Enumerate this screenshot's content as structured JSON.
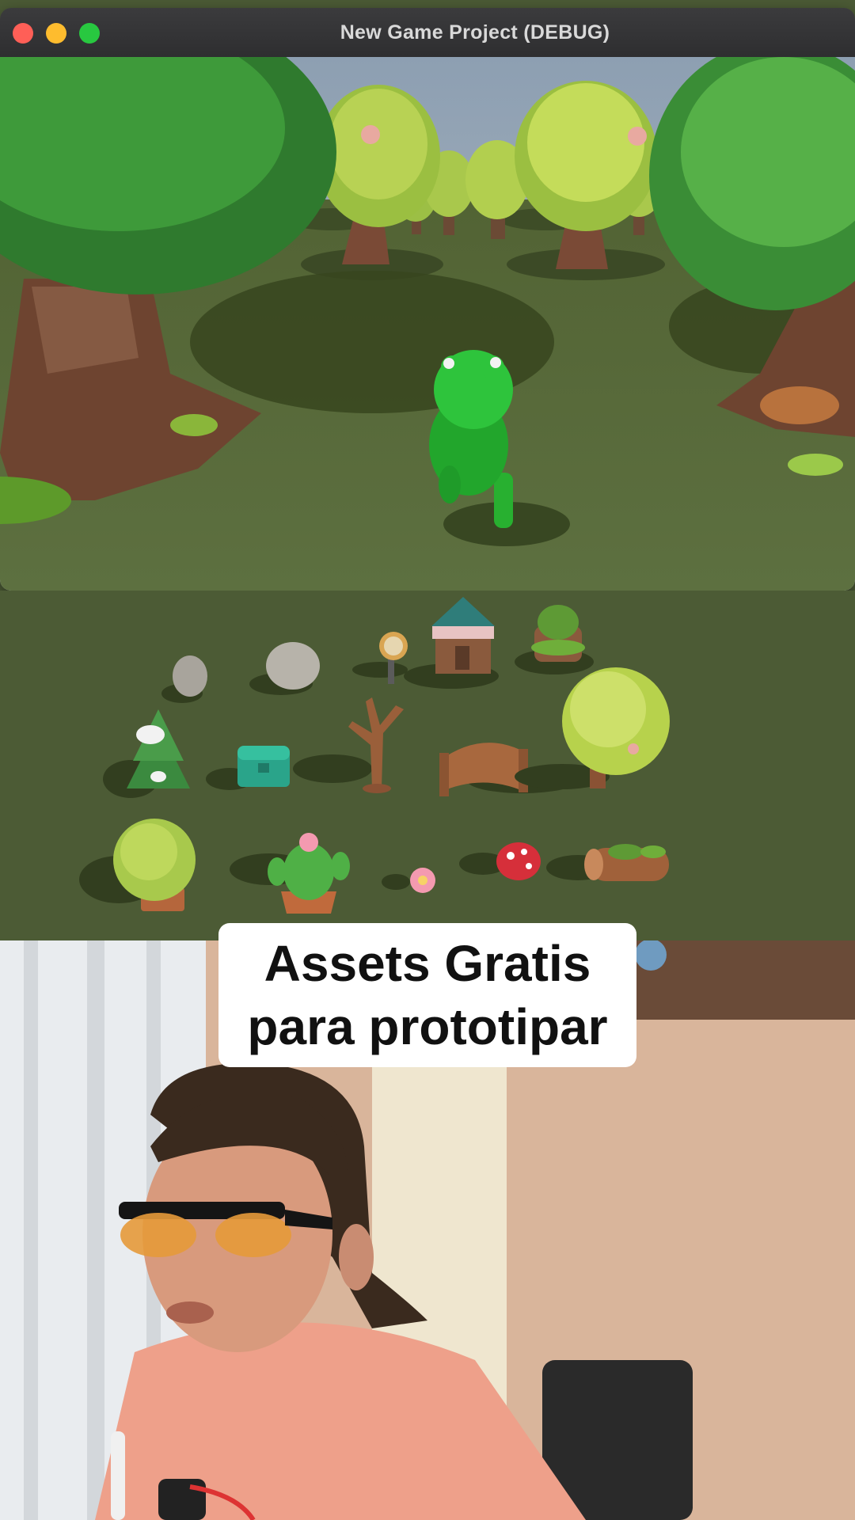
{
  "window": {
    "title": "New Game Project (DEBUG)",
    "buttons": [
      "close",
      "minimize",
      "maximize"
    ]
  },
  "caption": {
    "line1": "Assets Gratis",
    "line2": "para prototipar"
  },
  "scene": {
    "player_character": "frog",
    "gallery_assets": [
      "rock",
      "boulder",
      "signpost",
      "shop-house",
      "mossy-stump",
      "snowy-pine",
      "treasure-chest",
      "bare-tree",
      "wooden-bridge",
      "leafy-tree",
      "round-bush",
      "cactus-pot",
      "pink-flower",
      "mushroom",
      "mossy-log"
    ]
  },
  "colors": {
    "grass": "#55693d",
    "tree_foliage": "#c4dc5a",
    "frog": "#2ec43c",
    "caption_bg": "#ffffff"
  }
}
